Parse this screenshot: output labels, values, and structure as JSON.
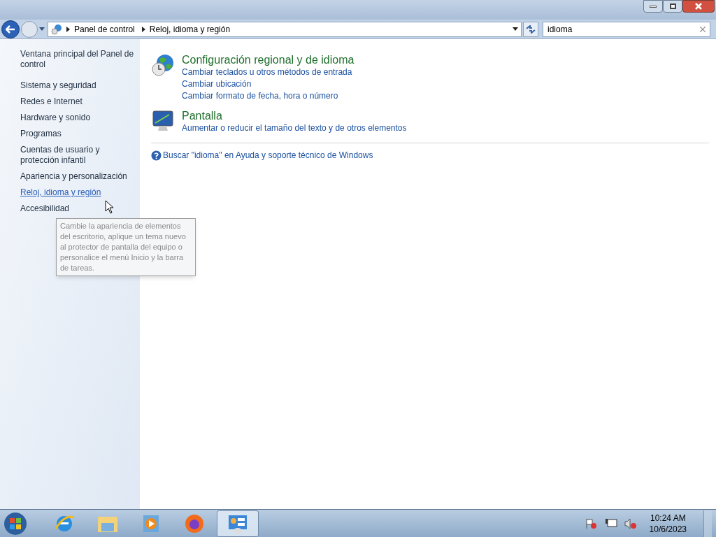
{
  "address_bar": {
    "breadcrumbs": [
      "Panel de control",
      "Reloj, idioma y región"
    ]
  },
  "search": {
    "value": "idioma"
  },
  "sidebar": {
    "items": [
      {
        "label": "Ventana principal del Panel de control",
        "selected": false
      },
      {
        "label": "Sistema y seguridad",
        "selected": false
      },
      {
        "label": "Redes e Internet",
        "selected": false
      },
      {
        "label": "Hardware y sonido",
        "selected": false
      },
      {
        "label": "Programas",
        "selected": false
      },
      {
        "label": "Cuentas de usuario y protección infantil",
        "selected": false
      },
      {
        "label": "Apariencia y personalización",
        "selected": false
      },
      {
        "label": "Reloj, idioma y región",
        "selected": true
      },
      {
        "label": "Accesibilidad",
        "selected": false
      }
    ]
  },
  "tooltip": "Cambie la apariencia de elementos del escritorio, aplique un tema nuevo al protector de pantalla del equipo o personalice el menú Inicio y la barra de tareas.",
  "results": [
    {
      "kind": "globe",
      "title": "Configuración regional y de idioma",
      "links": [
        "Cambiar teclados u otros métodos de entrada",
        "Cambiar ubicación",
        "Cambiar formato de fecha, hora o número"
      ]
    },
    {
      "kind": "monitor",
      "title": "Pantalla",
      "links": [
        "Aumentar o reducir el tamaño del texto y de otros elementos"
      ]
    }
  ],
  "help_link": "Buscar \"idioma\" en Ayuda y soporte técnico de Windows",
  "taskbar": {
    "apps": [
      {
        "kind": "ie",
        "selected": false
      },
      {
        "kind": "folder",
        "selected": false
      },
      {
        "kind": "media",
        "selected": false
      },
      {
        "kind": "firefox",
        "selected": false
      },
      {
        "kind": "control",
        "selected": true
      }
    ],
    "time": "10:24 AM",
    "date": "10/6/2023"
  }
}
